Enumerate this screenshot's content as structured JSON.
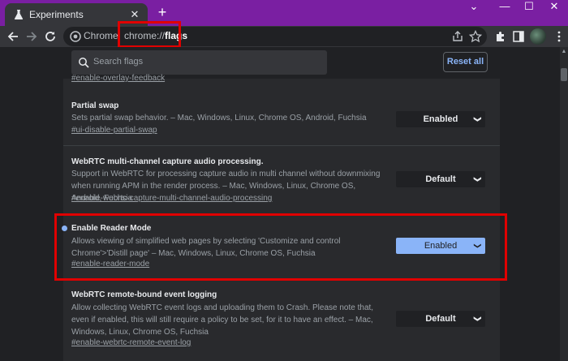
{
  "tab": {
    "title": "Experiments",
    "close_glyph": "✕"
  },
  "window_controls": {
    "minimize": "—",
    "maximize": "☐",
    "close": "✕",
    "dropdown": "⌄"
  },
  "omnibox": {
    "origin": "Chrome",
    "separator": "|",
    "url_prefix": "chrome://",
    "url_path": "flags"
  },
  "search": {
    "placeholder": "Search flags"
  },
  "reset_button": {
    "label": "Reset all"
  },
  "cut_off_link": "#enable-overlay-feedback",
  "flags": [
    {
      "name": "Partial swap",
      "description": "Sets partial swap behavior. – Mac, Windows, Linux, Chrome OS, Android, Fuchsia",
      "link": "#ui-disable-partial-swap",
      "value": "Enabled",
      "modified": false
    },
    {
      "name": "WebRTC multi-channel capture audio processing.",
      "description": "Support in WebRTC for processing capture audio in multi channel without downmixing when running APM in the render process. – Mac, Windows, Linux, Chrome OS, Android, Fuchsia",
      "link": "#enable-webrtc-capture-multi-channel-audio-processing",
      "value": "Default",
      "modified": false
    },
    {
      "name": "Enable Reader Mode",
      "description": "Allows viewing of simplified web pages by selecting 'Customize and control Chrome'>'Distill page' – Mac, Windows, Linux, Chrome OS, Fuchsia",
      "link": "#enable-reader-mode",
      "value": "Enabled",
      "modified": true
    },
    {
      "name": "WebRTC remote-bound event logging",
      "description": "Allow collecting WebRTC event logs and uploading them to Crash. Please note that, even if enabled, this will still require a policy to be set, for it to have an effect. – Mac, Windows, Linux, Chrome OS, Fuchsia",
      "link": "#enable-webrtc-remote-event-log",
      "value": "Default",
      "modified": false
    }
  ],
  "colors": {
    "titlebar": "#7a1fa2",
    "highlight": "#e00000",
    "accent": "#8ab4f8"
  }
}
